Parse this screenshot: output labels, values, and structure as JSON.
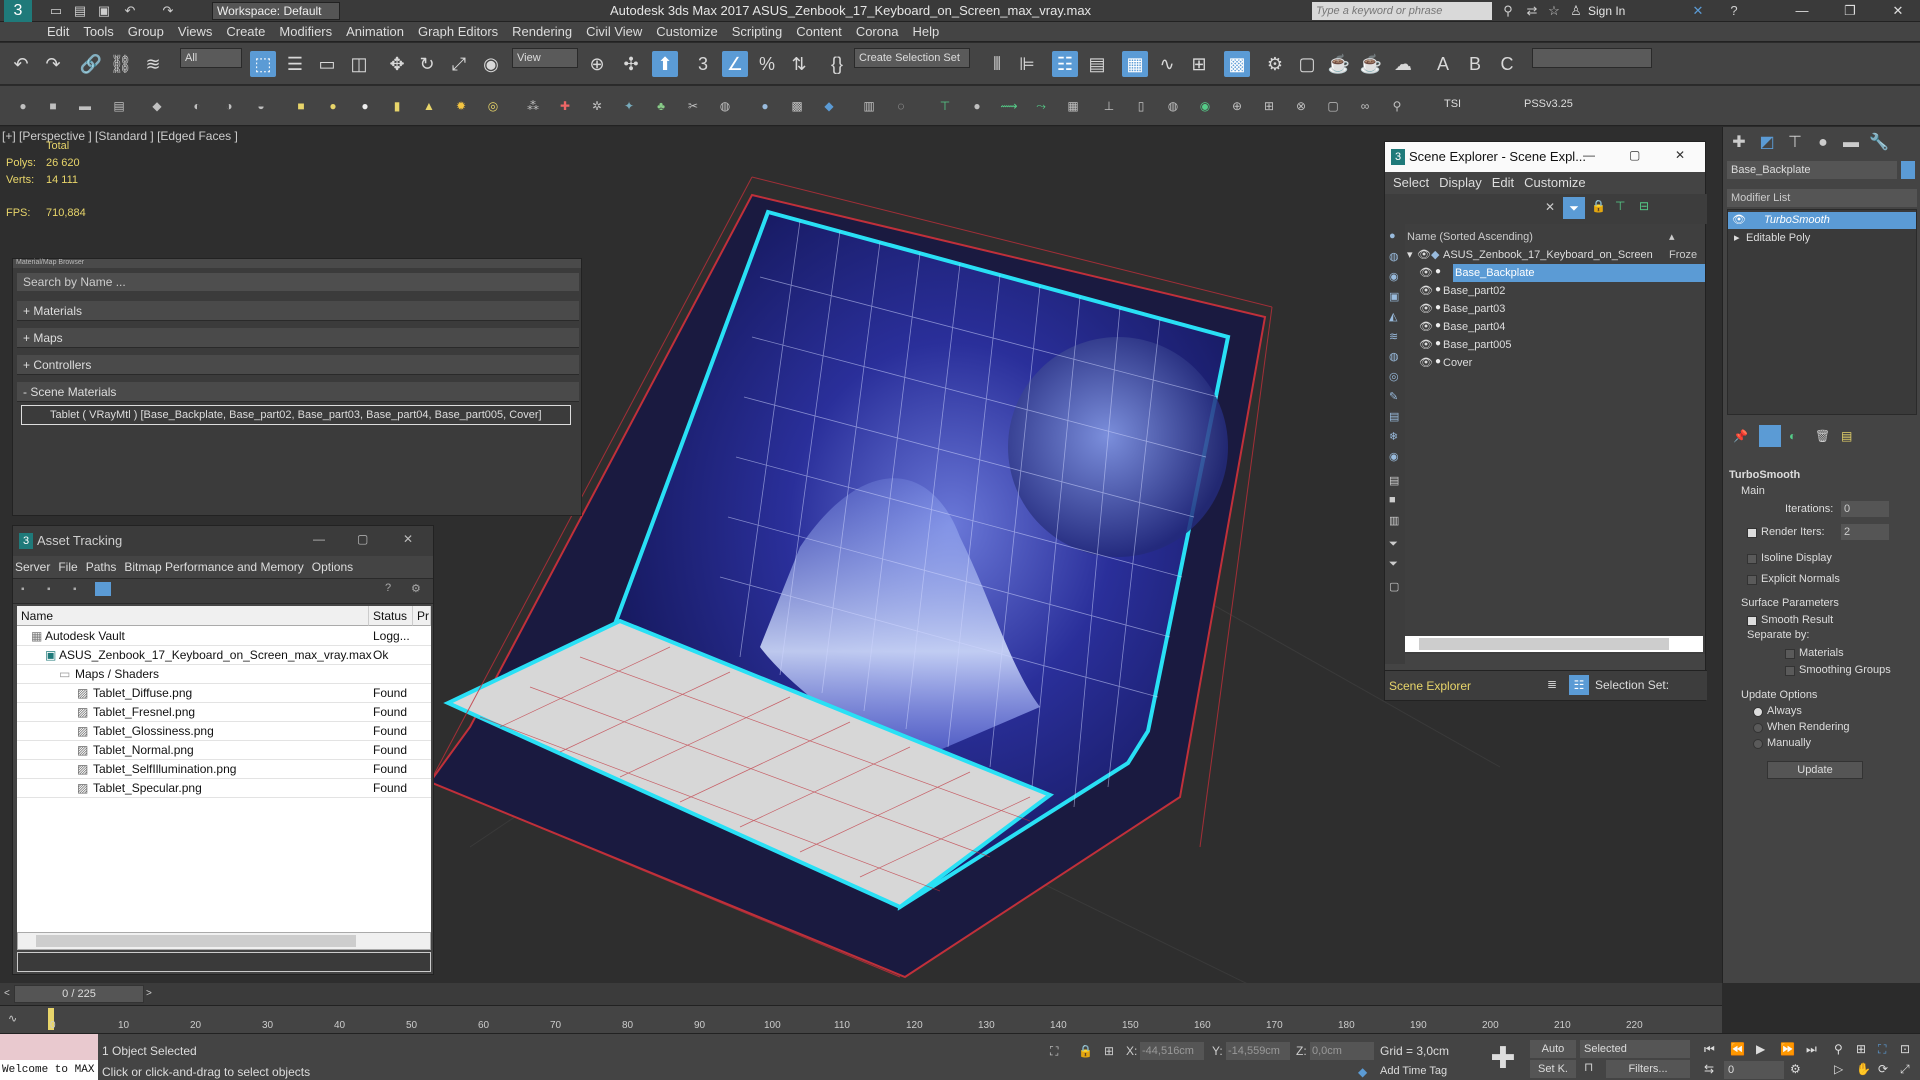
{
  "titlebar": {
    "workspace": "Workspace: Default",
    "title": "Autodesk 3ds Max 2017     ASUS_Zenbook_17_Keyboard_on_Screen_max_vray.max",
    "search_placeholder": "Type a keyword or phrase",
    "sign_in": "Sign In"
  },
  "menubar": {
    "items": [
      "Edit",
      "Tools",
      "Group",
      "Views",
      "Create",
      "Modifiers",
      "Animation",
      "Graph Editors",
      "Rendering",
      "Civil View",
      "Customize",
      "Scripting",
      "Content",
      "Corona",
      "Help"
    ]
  },
  "toolbar": {
    "filter_dropdown": "All",
    "view_dropdown": "View",
    "create_selection_set": "Create Selection Set",
    "labels": {
      "tsi": "TSI",
      "pssv": "PSSv3.25"
    }
  },
  "viewport": {
    "label": "[+] [Perspective ]  [Standard ]  [Edged Faces ]",
    "stats": {
      "total": "Total",
      "polys_label": "Polys:",
      "polys": "26 620",
      "verts_label": "Verts:",
      "verts": "14 111",
      "fps_label": "FPS:",
      "fps": "710,884"
    }
  },
  "material_browser": {
    "header": "Material/Map Browser",
    "search": "Search by Name ...",
    "groups": [
      "+ Materials",
      "+ Maps",
      "+ Controllers",
      "- Scene Materials"
    ],
    "entry": "Tablet  ( VRayMtl )  [Base_Backplate, Base_part02, Base_part03, Base_part04, Base_part005, Cover]"
  },
  "asset_tracking": {
    "title": "Asset Tracking",
    "menus": [
      "Server",
      "File",
      "Paths",
      "Bitmap Performance and Memory",
      "Options"
    ],
    "columns": [
      "Name",
      "Status",
      "Pr"
    ],
    "rows": [
      {
        "name": "Autodesk Vault",
        "status": "Logg..."
      },
      {
        "name": "ASUS_Zenbook_17_Keyboard_on_Screen_max_vray.max",
        "status": "Ok"
      },
      {
        "name": "Maps / Shaders",
        "status": ""
      },
      {
        "name": "Tablet_Diffuse.png",
        "status": "Found"
      },
      {
        "name": "Tablet_Fresnel.png",
        "status": "Found"
      },
      {
        "name": "Tablet_Glossiness.png",
        "status": "Found"
      },
      {
        "name": "Tablet_Normal.png",
        "status": "Found"
      },
      {
        "name": "Tablet_SelfIllumination.png",
        "status": "Found"
      },
      {
        "name": "Tablet_Specular.png",
        "status": "Found"
      }
    ]
  },
  "scene_explorer": {
    "title": "Scene Explorer - Scene Expl...",
    "menus": [
      "Select",
      "Display",
      "Edit",
      "Customize"
    ],
    "column": "Name (Sorted Ascending)",
    "column2": "▴ Froze",
    "root": "ASUS_Zenbook_17_Keyboard_on_Screen",
    "items": [
      "Base_Backplate",
      "Base_part02",
      "Base_part03",
      "Base_part04",
      "Base_part005",
      "Cover"
    ],
    "selected": "Base_Backplate",
    "footer_label": "Scene Explorer",
    "selection_set": "Selection Set:"
  },
  "command_panel": {
    "object_name": "Base_Backplate",
    "modifier_list": "Modifier List",
    "stack": [
      "TurboSmooth",
      "Editable Poly"
    ],
    "rollout": "TurboSmooth",
    "main": "Main",
    "iterations_label": "Iterations:",
    "iterations": "0",
    "render_iters_label": "Render Iters:",
    "render_iters": "2",
    "isoline": "Isoline Display",
    "explicit_normals": "Explicit Normals",
    "surface_params": "Surface Parameters",
    "smooth_result": "Smooth Result",
    "separate_by": "Separate by:",
    "materials": "Materials",
    "smoothing_groups": "Smoothing Groups",
    "update_options": "Update Options",
    "always": "Always",
    "when_rendering": "When Rendering",
    "manually": "Manually",
    "update_button": "Update"
  },
  "timeline": {
    "frame": "0 / 225",
    "ticks": [
      "0",
      "10",
      "20",
      "30",
      "40",
      "50",
      "60",
      "70",
      "80",
      "90",
      "100",
      "110",
      "120",
      "130",
      "140",
      "150",
      "160",
      "170",
      "180",
      "190",
      "200",
      "210",
      "220"
    ]
  },
  "statusbar": {
    "welcome": "Welcome to MAX",
    "selected": "1 Object Selected",
    "hint": "Click or click-and-drag to select objects",
    "x_label": "X:",
    "x": "-44,516cm",
    "y_label": "Y:",
    "y": "-14,559cm",
    "z_label": "Z:",
    "z": "0,0cm",
    "grid": "Grid = 3,0cm",
    "add_time_tag": "Add Time Tag",
    "auto": "Auto",
    "selected_dropdown": "Selected",
    "set_key": "Set K.",
    "filters": "Filters...",
    "frame_spinner": "0"
  },
  "colors": {
    "accent": "#5b9bd5",
    "wire_cyan": "#29e0f5",
    "wire_red": "#c0303a"
  }
}
